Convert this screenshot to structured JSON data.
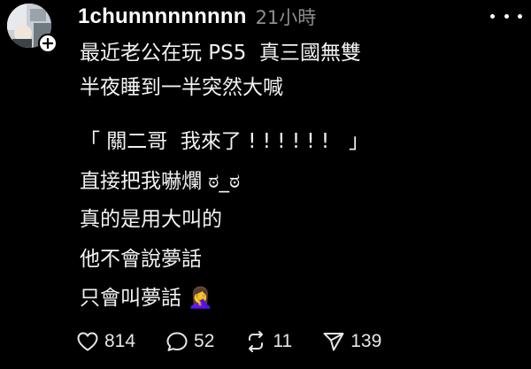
{
  "post": {
    "username": "1chunnnnnnnnn",
    "time": "21小時",
    "lines": [
      "最近老公在玩 PS5  真三國無雙",
      "半夜睡到一半突然大喊",
      "「 關二哥  我來了 ! ! ! ! ! !   」",
      "直接把我嚇爛 ಠ_ಠ",
      "真的是用大叫的",
      "他不會說夢話",
      "只會叫夢話 🤦‍♀️"
    ]
  },
  "actions": {
    "likes": "814",
    "comments": "52",
    "reposts": "11",
    "shares": "139"
  },
  "icons": {
    "like": "heart-icon",
    "comment": "comment-bubble-icon",
    "repost": "repost-icon",
    "share": "send-icon",
    "more": "more-dots-icon",
    "follow": "plus-icon"
  },
  "colors": {
    "background": "#000000",
    "text": "#f2f2f2",
    "muted": "#8e8e8e"
  }
}
